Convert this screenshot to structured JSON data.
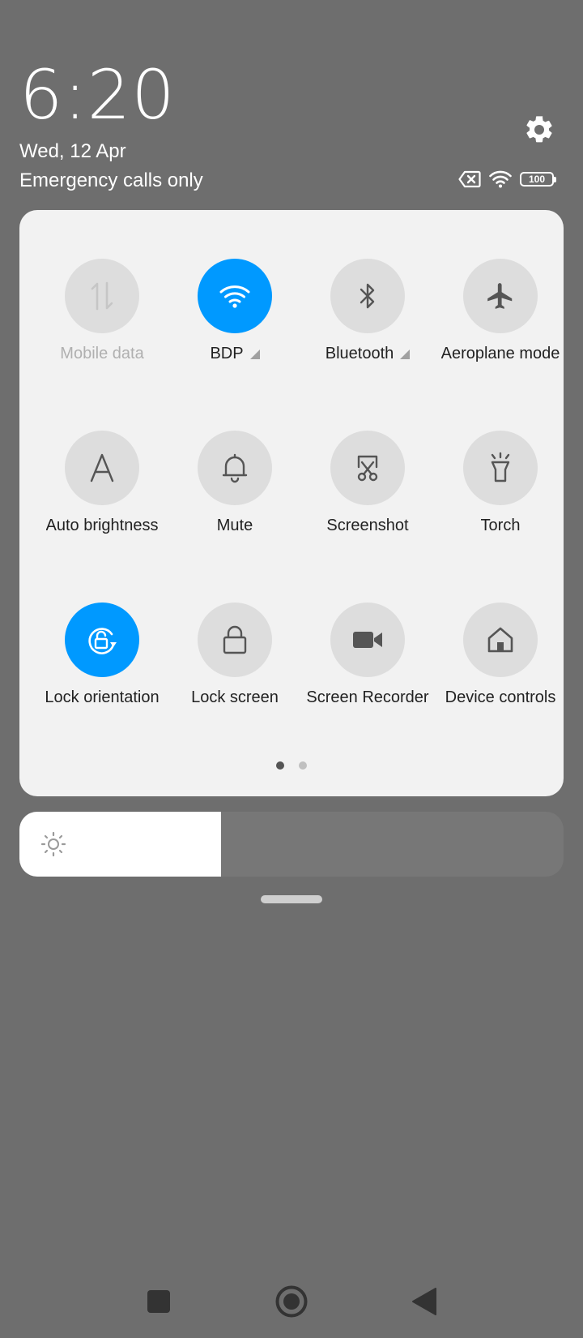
{
  "header": {
    "time": "6:20",
    "date": "Wed, 12 Apr",
    "carrier_status": "Emergency calls only",
    "battery_level": "100"
  },
  "tiles": [
    {
      "label": "Mobile data",
      "icon": "mobile-data-icon",
      "state": "disabled"
    },
    {
      "label": "BDP",
      "icon": "wifi-icon",
      "state": "active",
      "has_arrow": true
    },
    {
      "label": "Bluetooth",
      "icon": "bluetooth-icon",
      "state": "inactive",
      "has_arrow": true
    },
    {
      "label": "Aeroplane mode",
      "icon": "airplane-icon",
      "state": "inactive"
    },
    {
      "label": "Auto brightness",
      "icon": "auto-brightness-icon",
      "state": "inactive"
    },
    {
      "label": "Mute",
      "icon": "bell-icon",
      "state": "inactive"
    },
    {
      "label": "Screenshot",
      "icon": "scissors-icon",
      "state": "inactive"
    },
    {
      "label": "Torch",
      "icon": "torch-icon",
      "state": "inactive"
    },
    {
      "label": "Lock orientation",
      "icon": "rotation-lock-icon",
      "state": "active"
    },
    {
      "label": "Lock screen",
      "icon": "lock-icon",
      "state": "inactive"
    },
    {
      "label": "Screen Recorder",
      "icon": "video-camera-icon",
      "state": "inactive"
    },
    {
      "label": "Device controls",
      "icon": "home-icon",
      "state": "inactive"
    }
  ],
  "pager": {
    "current_page": 1,
    "total_pages": 2
  },
  "brightness": {
    "level": 0.37
  },
  "colors": {
    "accent": "#0099ff",
    "background": "#6e6e6e",
    "panel": "#f2f2f2",
    "tile_inactive": "#dddddd"
  }
}
